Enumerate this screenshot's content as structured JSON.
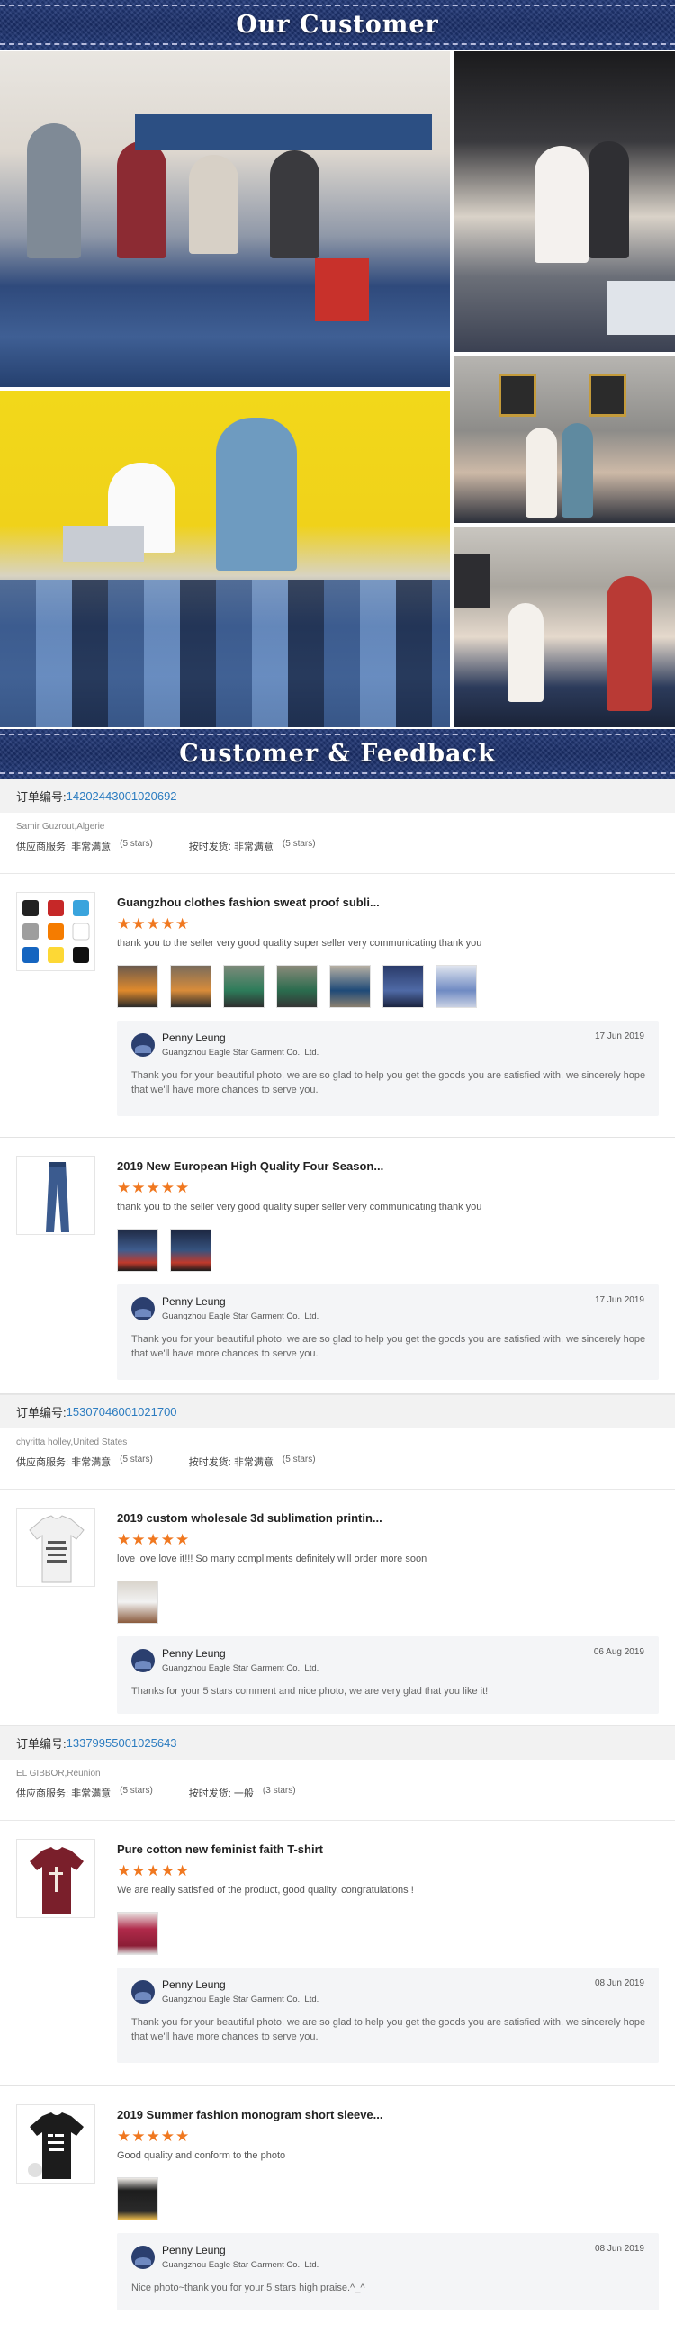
{
  "banner_top": {
    "title": "Our Customer"
  },
  "banner_feedback": {
    "title": "Customer & Feedback"
  },
  "star_glyphs": "★★★★★",
  "seller": {
    "name": "Penny Leung",
    "company": "Guangzhou Eagle Star Garment Co., Ltd."
  },
  "orders": [
    {
      "order_label": "订单编号:",
      "order_no": "14202443001020692",
      "buyer": "Samir Guzrout,Algerie",
      "rating1_label": "供应商服务: 非常满意",
      "rating1_stars": "(5 stars)",
      "rating2_label": "按时发货: 非常满意",
      "rating2_stars": "(5 stars)",
      "items": [
        {
          "title": "Guangzhou clothes fashion sweat proof subli...",
          "comment": "thank you to the seller very good quality super seller very communicating thank you",
          "reply_date": "17 Jun 2019",
          "reply_text": "Thank you for your beautiful photo, we are so glad to help you get the goods you are satisfied with, we sincerely hope that we'll have more chances to serve you."
        },
        {
          "title": "2019 New European High Quality Four Season...",
          "comment": "thank you to the seller very good quality super seller very communicating thank you",
          "reply_date": "17 Jun 2019",
          "reply_text": "Thank you for your beautiful photo, we are so glad to help you get the goods you are satisfied with, we sincerely hope that we'll have more chances to serve you."
        }
      ]
    },
    {
      "order_label": "订单编号:",
      "order_no": "15307046001021700",
      "buyer": "chyritta holley,United States",
      "rating1_label": "供应商服务: 非常满意",
      "rating1_stars": "(5 stars)",
      "rating2_label": "按时发货: 非常满意",
      "rating2_stars": "(5 stars)",
      "items": [
        {
          "title": "2019 custom wholesale 3d sublimation printin...",
          "comment": "love love love it!!! So many compliments definitely will order more soon",
          "reply_date": "06 Aug 2019",
          "reply_text": "Thanks for your 5 stars comment and nice photo, we are very glad that you like it!"
        }
      ]
    },
    {
      "order_label": "订单编号:",
      "order_no": "13379955001025643",
      "buyer": "EL GIBBOR,Reunion",
      "rating1_label": "供应商服务: 非常满意",
      "rating1_stars": "(5 stars)",
      "rating2_label": "按时发货: 一般",
      "rating2_stars": "(3 stars)",
      "items": [
        {
          "title": "Pure cotton new feminist faith T-shirt",
          "comment": "We are really satisfied of the product, good quality, congratulations !",
          "reply_date": "08 Jun 2019",
          "reply_text": "Thank you for your beautiful photo, we are so glad to help you get the goods you are satisfied with, we sincerely hope that we'll have more chances to serve you."
        },
        {
          "title": "2019 Summer fashion monogram short sleeve...",
          "comment": "Good quality and conform to the photo",
          "reply_date": "08 Jun 2019",
          "reply_text": "Nice photo~thank you for your 5 stars high praise.^_^"
        }
      ]
    }
  ]
}
